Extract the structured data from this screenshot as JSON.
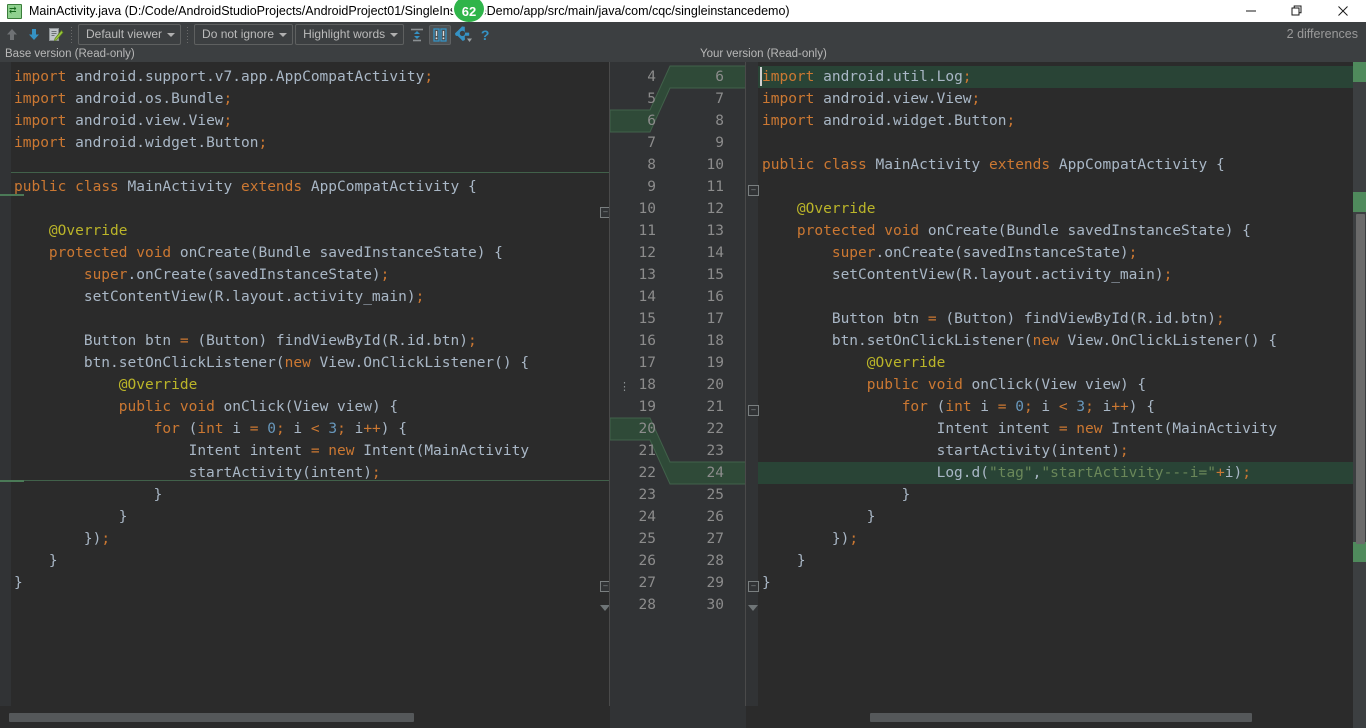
{
  "window": {
    "title": "MainActivity.java (D:/Code/AndroidStudioProjects/AndroidProject01/SingleInstanceDemo/app/src/main/java/com/cqc/singleinstancedemo)",
    "icon": "diff-file-icon",
    "badge_count": "62",
    "controls": {
      "minimize": "minimize-icon",
      "restore": "restore-icon",
      "close": "close-icon"
    }
  },
  "toolbar": {
    "prev_diff": "previous-difference",
    "next_diff": "next-difference",
    "apply": "apply-changes",
    "viewer_select": "Default viewer",
    "whitespace_select": "Do not ignore",
    "highlight_select": "Highlight words",
    "collapse": "collapse-unchanged-fragments",
    "sync_scroll": "synchronize-scrolling",
    "settings": "settings-gear",
    "help": "?",
    "difference_count": "2 differences"
  },
  "panes": {
    "left_header": "Base version (Read-only)",
    "right_header": "Your version (Read-only)"
  },
  "left_line_numbers": [
    "4",
    "5",
    "6",
    "7",
    "8",
    "9",
    "10",
    "11",
    "12",
    "13",
    "14",
    "15",
    "16",
    "17",
    "18",
    "19",
    "20",
    "21",
    "22",
    "23",
    "24",
    "25",
    "26",
    "27",
    "28"
  ],
  "right_line_numbers": [
    "6",
    "7",
    "8",
    "9",
    "10",
    "11",
    "12",
    "13",
    "14",
    "15",
    "16",
    "17",
    "18",
    "19",
    "20",
    "21",
    "22",
    "23",
    "24",
    "25",
    "26",
    "27",
    "28",
    "29",
    "30"
  ],
  "left_code": [
    "import android.support.v7.app.AppCompatActivity;",
    "import android.os.Bundle;",
    "import android.view.View;",
    "import android.widget.Button;",
    "",
    "public class MainActivity extends AppCompatActivity {",
    "",
    "    @Override",
    "    protected void onCreate(Bundle savedInstanceState) {",
    "        super.onCreate(savedInstanceState);",
    "        setContentView(R.layout.activity_main);",
    "",
    "        Button btn = (Button) findViewById(R.id.btn);",
    "        btn.setOnClickListener(new View.OnClickListener() {",
    "            @Override",
    "            public void onClick(View view) {",
    "                for (int i = 0; i < 3; i++) {",
    "                    Intent intent = new Intent(MainActivity",
    "                    startActivity(intent);",
    "                }",
    "            }",
    "        });",
    "    }",
    "}",
    ""
  ],
  "right_code": [
    "import android.util.Log;",
    "import android.view.View;",
    "import android.widget.Button;",
    "",
    "public class MainActivity extends AppCompatActivity {",
    "",
    "    @Override",
    "    protected void onCreate(Bundle savedInstanceState) {",
    "        super.onCreate(savedInstanceState);",
    "        setContentView(R.layout.activity_main);",
    "",
    "        Button btn = (Button) findViewById(R.id.btn);",
    "        btn.setOnClickListener(new View.OnClickListener() {",
    "            @Override",
    "            public void onClick(View view) {",
    "                for (int i = 0; i < 3; i++) {",
    "                    Intent intent = new Intent(MainActivity",
    "                    startActivity(intent);",
    "                    Log.d(\"tag\",\"startActivity---i=\"+i);",
    "                }",
    "            }",
    "        });",
    "    }",
    "}",
    ""
  ],
  "colors": {
    "editor_bg": "#2b2b2b",
    "chrome_bg": "#3c3f41",
    "gutter_bg": "#313335",
    "default_text": "#a9b7c6",
    "keyword": "#cc7832",
    "number": "#6897bb",
    "annotation": "#bbb529",
    "string": "#6a8759",
    "diff_inserted": "#294436",
    "badge_green": "#2fb44a",
    "accent_blue": "#3592c4"
  }
}
